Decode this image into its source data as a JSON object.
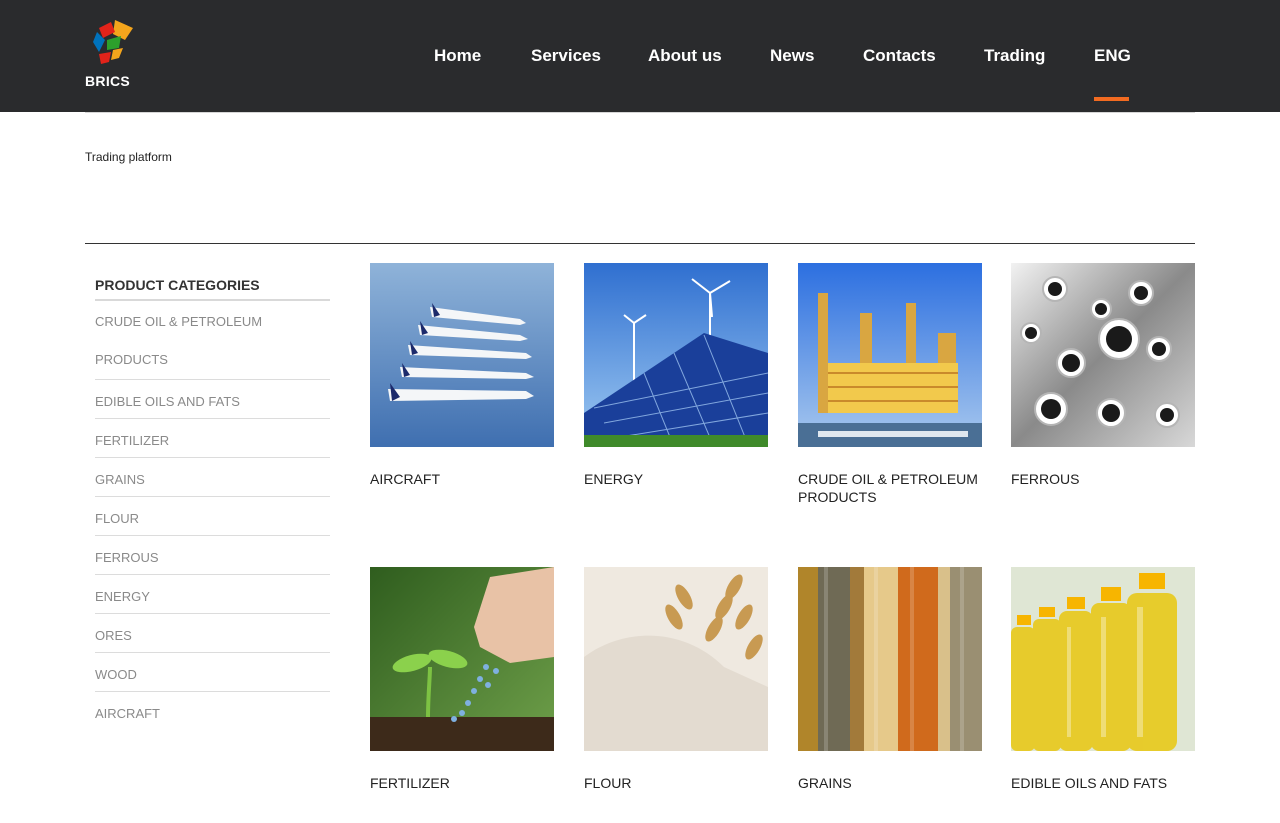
{
  "header": {
    "logo_text": "BRICS",
    "nav": [
      {
        "label": "Home"
      },
      {
        "label": "Services"
      },
      {
        "label": "About us"
      },
      {
        "label": "News"
      },
      {
        "label": "Contacts"
      },
      {
        "label": "Trading"
      },
      {
        "label": "ENG"
      }
    ],
    "active_color": "#f26b21",
    "background": "#2a2b2d"
  },
  "breadcrumb": "Trading platform",
  "sidebar": {
    "title": "PRODUCT CATEGORIES",
    "items": [
      {
        "label": "CRUDE OIL & PETROLEUM PRODUCTS"
      },
      {
        "label": "EDIBLE OILS AND FATS"
      },
      {
        "label": "FERTILIZER"
      },
      {
        "label": "GRAINS"
      },
      {
        "label": "FLOUR"
      },
      {
        "label": "FERROUS"
      },
      {
        "label": "ENERGY"
      },
      {
        "label": "ORES"
      },
      {
        "label": "WOOD"
      },
      {
        "label": "AIRCRAFT"
      }
    ]
  },
  "products": [
    {
      "title": "AIRCRAFT",
      "icon": "aircraft-image"
    },
    {
      "title": "ENERGY",
      "icon": "solar-panel-image"
    },
    {
      "title": "CRUDE OIL & PETROLEUM PRODUCTS",
      "icon": "refinery-image"
    },
    {
      "title": "FERROUS",
      "icon": "steel-pipes-image"
    },
    {
      "title": "FERTILIZER",
      "icon": "fertilizer-image"
    },
    {
      "title": "FLOUR",
      "icon": "flour-image"
    },
    {
      "title": "GRAINS",
      "icon": "grains-image"
    },
    {
      "title": "EDIBLE OILS AND FATS",
      "icon": "oil-bottles-image"
    }
  ]
}
